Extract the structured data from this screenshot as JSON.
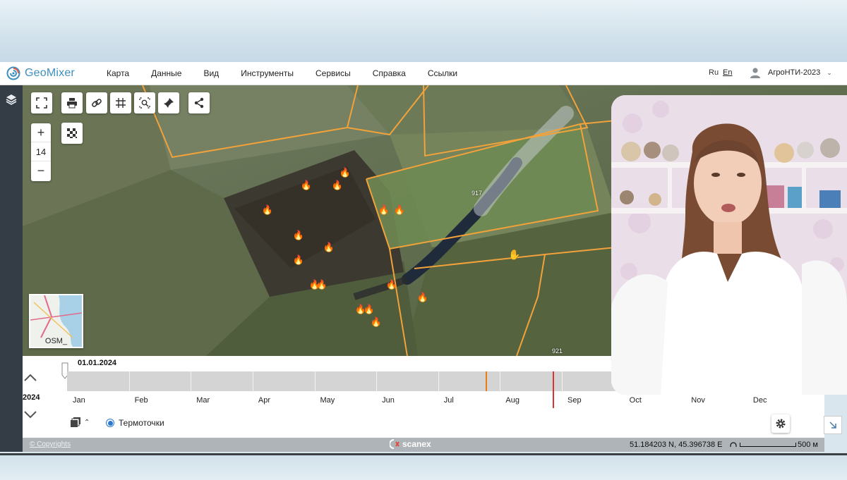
{
  "app": {
    "logo_text": "GeoMixer",
    "brand_color": "#3d8fbf"
  },
  "menu": {
    "items": [
      "Карта",
      "Данные",
      "Вид",
      "Инструменты",
      "Сервисы",
      "Справка",
      "Ссылки"
    ]
  },
  "lang": {
    "ru": "Ru",
    "en": "En",
    "active": "En"
  },
  "user": {
    "name": "АгроНТИ-2023",
    "icon": "user-icon"
  },
  "map_tools": {
    "icons": [
      "fullscreen-icon",
      "print-icon",
      "link-icon",
      "grid-icon",
      "zoom-search-icon",
      "pin-icon",
      "share-icon",
      "checker-icon"
    ]
  },
  "zoom": {
    "plus": "+",
    "level": "14",
    "minus": "−"
  },
  "minimap": {
    "label": "OSM_"
  },
  "parcels": {
    "label_a": "917",
    "label_b": "921"
  },
  "timeline": {
    "current_date": "01.01.2024",
    "year": "2024",
    "months": [
      "Jan",
      "Feb",
      "Mar",
      "Apr",
      "May",
      "Jun",
      "Jul",
      "Aug",
      "Sep",
      "Oct",
      "Nov",
      "Dec"
    ],
    "events": [
      {
        "position": 0.553,
        "color": "#f07a12"
      },
      {
        "position": 0.641,
        "color": "#d9332b"
      }
    ],
    "layer_name": "Термоточки",
    "event_color_fire": "#f07a12"
  },
  "statusbar": {
    "copyright": "© Copyrights",
    "brand": "scanex",
    "coords": "51.184203 N, 45.396738 E",
    "scale_label": "500 м"
  }
}
